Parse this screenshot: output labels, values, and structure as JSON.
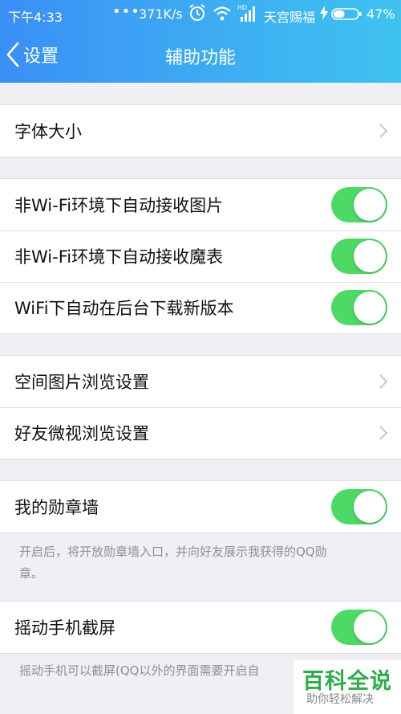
{
  "status_bar": {
    "time": "下午4:33",
    "dots": "•••",
    "net_speed": "371K/s",
    "carrier": "天宫赐福",
    "battery_percent": "47%",
    "battery_level": 0.47,
    "icons": [
      "alarm-icon",
      "wifi-icon",
      "hd-signal-icon",
      "charging-bolt-icon",
      "battery-icon"
    ]
  },
  "nav": {
    "back_label": "设置",
    "title": "辅助功能"
  },
  "groups": [
    {
      "items": [
        {
          "label": "字体大小",
          "control": "chevron"
        }
      ]
    },
    {
      "items": [
        {
          "label": "非Wi-Fi环境下自动接收图片",
          "control": "toggle",
          "on": true
        },
        {
          "label": "非Wi-Fi环境下自动接收魔表",
          "control": "toggle",
          "on": true
        },
        {
          "label": "WiFi下自动在后台下载新版本",
          "control": "toggle",
          "on": true
        }
      ]
    },
    {
      "items": [
        {
          "label": "空间图片浏览设置",
          "control": "chevron"
        },
        {
          "label": "好友微视浏览设置",
          "control": "chevron"
        }
      ]
    },
    {
      "items": [
        {
          "label": "我的勋章墙",
          "control": "toggle",
          "on": true
        }
      ],
      "note": [
        "开启后，将开放勋章墙入口，并向好友展示我获得的QQ勋",
        "章。"
      ]
    },
    {
      "items": [
        {
          "label": "摇动手机截屏",
          "control": "toggle",
          "on": true
        }
      ],
      "note": [
        "摇动手机可以截屏(QQ以外的界面需要开启自"
      ]
    }
  ],
  "watermark": {
    "title": "百科全说",
    "subtitle": "助你轻松解决"
  },
  "colors": {
    "header_gradient_start": "#3a8ff5",
    "header_gradient_end": "#3fc2ef",
    "toggle_on": "#4cd964",
    "background": "#efeff4",
    "watermark_green": "#2dac4a"
  }
}
